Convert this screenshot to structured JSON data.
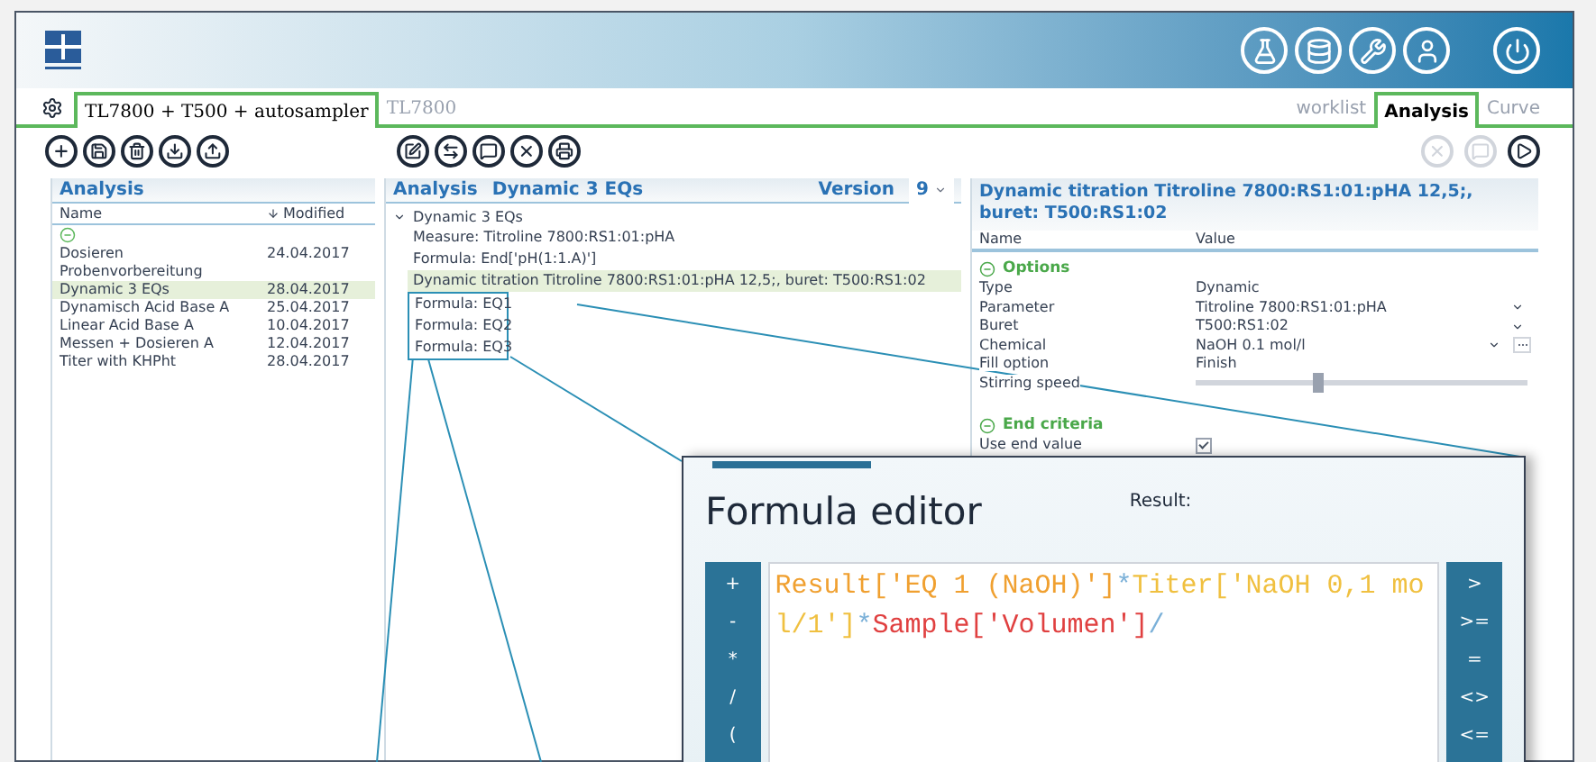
{
  "device_tabs": [
    {
      "label": "TL7800 + T500 + autosampler",
      "selected": true
    },
    {
      "label": "TL7800",
      "selected": false
    }
  ],
  "view_tabs": [
    {
      "label": "worklist",
      "selected": false
    },
    {
      "label": "Analysis",
      "selected": true
    },
    {
      "label": "Curve",
      "selected": false
    }
  ],
  "run_controls": [
    {
      "kind": "stop",
      "disabled": true
    },
    {
      "kind": "message",
      "disabled": true
    },
    {
      "kind": "play",
      "disabled": false
    }
  ],
  "analysis_list": {
    "title": "Analysis",
    "columns": [
      "Name",
      "Modified"
    ],
    "rows": [
      {
        "name": "Dosieren Probenvorbereitung",
        "modified": "24.04.2017",
        "selected": false
      },
      {
        "name": "Dynamic 3 EQs",
        "modified": "28.04.2017",
        "selected": true
      },
      {
        "name": "Dynamisch Acid Base A",
        "modified": "25.04.2017",
        "selected": false
      },
      {
        "name": "Linear Acid Base A",
        "modified": "10.04.2017",
        "selected": false
      },
      {
        "name": "Messen + Dosieren A",
        "modified": "12.04.2017",
        "selected": false
      },
      {
        "name": "Titer with KHPht",
        "modified": "28.04.2017",
        "selected": false
      }
    ]
  },
  "method": {
    "title": "Analysis",
    "name": "Dynamic 3 EQs",
    "version_label": "Version",
    "version": "9",
    "tree": {
      "label": "Dynamic 3 EQs",
      "expanded": true,
      "children": [
        {
          "label": "Measure: Titroline 7800:RS1:01:pHA",
          "selected": false,
          "framed": false
        },
        {
          "label": "Formula: End['pH(1:1.A)']",
          "selected": false,
          "framed": false
        },
        {
          "label": "Dynamic titration Titroline 7800:RS1:01:pHA 12,5;, buret: T500:RS1:02",
          "selected": true,
          "framed": false
        },
        {
          "label": "Formula: EQ1",
          "selected": false,
          "framed": true
        },
        {
          "label": "Formula: EQ2",
          "selected": false,
          "framed": true
        },
        {
          "label": "Formula: EQ3",
          "selected": false,
          "framed": true
        }
      ]
    }
  },
  "properties": {
    "title": "Dynamic titration Titroline 7800:RS1:01:pHA 12,5;, buret: T500:RS1:02",
    "columns": [
      "Name",
      "Value"
    ],
    "groups": [
      {
        "label": "Options",
        "expanded": true,
        "rows": [
          {
            "kind": "text",
            "name": "Type",
            "value": "Dynamic"
          },
          {
            "kind": "select",
            "name": "Parameter",
            "value": "Titroline 7800:RS1:01:pHA"
          },
          {
            "kind": "select",
            "name": "Buret",
            "value": "T500:RS1:02"
          },
          {
            "kind": "select_button",
            "name": "Chemical",
            "value": "NaOH 0.1 mol/l"
          },
          {
            "kind": "text",
            "name": "Fill option",
            "value": "Finish"
          },
          {
            "kind": "slider",
            "name": "Stirring speed",
            "level": 0.37
          }
        ]
      },
      {
        "label": "End criteria",
        "expanded": true,
        "rows": [
          {
            "kind": "checkbox",
            "name": "Use end value",
            "checked": true
          }
        ]
      }
    ]
  },
  "formula_editor": {
    "title": "Formula editor",
    "result_label": "Result:",
    "left_operators": [
      "+",
      "-",
      "*",
      "/",
      "("
    ],
    "right_operators": [
      ">",
      ">=",
      "=",
      "<>",
      "<="
    ],
    "tokens": [
      {
        "text": "Result['EQ 1 (NaOH)']",
        "color": "#f0a030"
      },
      {
        "text": "*",
        "color": "#7ab0d8"
      },
      {
        "text": "Titer['NaOH 0,1 mol/1']",
        "color": "#f0c040"
      },
      {
        "text": "*",
        "color": "#7ab0d8"
      },
      {
        "text": "Sample['Volumen']",
        "color": "#e04040"
      },
      {
        "text": "/",
        "color": "#7ab0d8"
      }
    ]
  }
}
